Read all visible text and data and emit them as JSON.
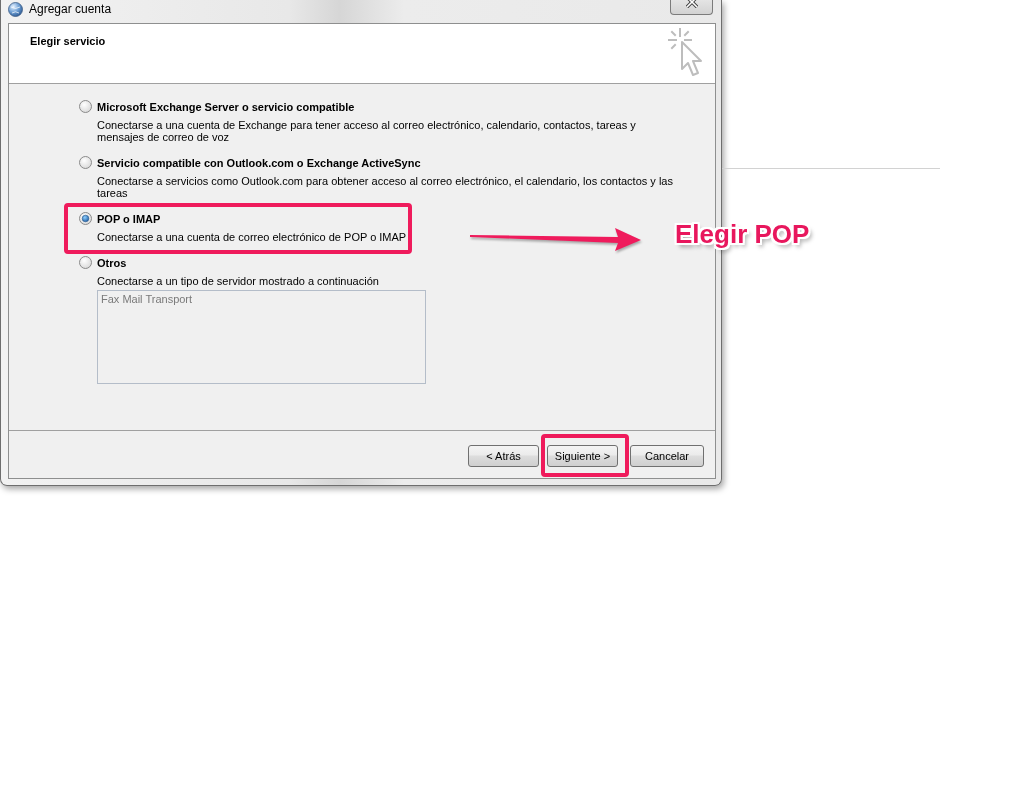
{
  "window": {
    "title": "Agregar cuenta"
  },
  "header": {
    "title": "Elegir servicio"
  },
  "options": [
    {
      "label": "Microsoft Exchange Server o servicio compatible",
      "description": "Conectarse a una cuenta de Exchange para tener acceso al correo electrónico, calendario, contactos, tareas y mensajes de correo de voz",
      "selected": false,
      "highlighted": false
    },
    {
      "label": "Servicio compatible con Outlook.com o Exchange ActiveSync",
      "description": "Conectarse a servicios como Outlook.com para obtener acceso al correo electrónico, el calendario, los contactos y las tareas",
      "selected": false,
      "highlighted": false
    },
    {
      "label": "POP o IMAP",
      "description": "Conectarse a una cuenta de correo electrónico de POP o IMAP",
      "selected": true,
      "highlighted": true
    },
    {
      "label": "Otros",
      "description": "Conectarse a un tipo de servidor mostrado a continuación",
      "selected": false,
      "highlighted": false,
      "list": {
        "disabled": true,
        "items": [
          "Fax Mail Transport"
        ]
      }
    }
  ],
  "buttons": [
    {
      "label": "< Atrás",
      "highlighted": false
    },
    {
      "label": "Siguiente >",
      "highlighted": true
    },
    {
      "label": "Cancelar",
      "highlighted": false
    }
  ],
  "annotation": {
    "label": "Elegir POP"
  }
}
